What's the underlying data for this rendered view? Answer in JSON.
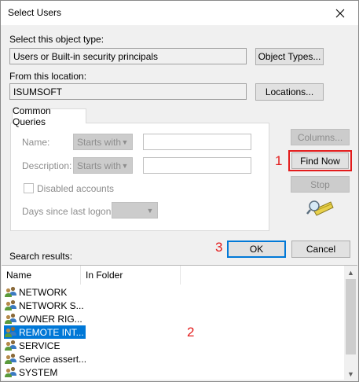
{
  "window": {
    "title": "Select Users"
  },
  "object_type": {
    "label": "Select this object type:",
    "value": "Users or Built-in security principals",
    "button": "Object Types..."
  },
  "location": {
    "label": "From this location:",
    "value": "ISUMSOFT",
    "button": "Locations..."
  },
  "queries": {
    "tab": "Common Queries",
    "name_label": "Name:",
    "description_label": "Description:",
    "starts_with": "Starts with",
    "disabled_accounts": "Disabled accounts",
    "days_label": "Days since last logon:"
  },
  "side_buttons": {
    "columns": "Columns...",
    "find_now": "Find Now",
    "stop": "Stop"
  },
  "dialog_buttons": {
    "ok": "OK",
    "cancel": "Cancel"
  },
  "annotations": {
    "step1": "1",
    "step2": "2",
    "step3": "3",
    "color": "#e31c1c"
  },
  "results": {
    "label": "Search results:",
    "columns": [
      "Name",
      "In Folder"
    ],
    "rows": [
      {
        "name": "NETWORK",
        "folder": ""
      },
      {
        "name": "NETWORK S...",
        "folder": ""
      },
      {
        "name": "OWNER RIG...",
        "folder": ""
      },
      {
        "name": "REMOTE INT...",
        "folder": "",
        "selected": true
      },
      {
        "name": "SERVICE",
        "folder": ""
      },
      {
        "name": "Service assert...",
        "folder": ""
      },
      {
        "name": "SYSTEM",
        "folder": ""
      }
    ]
  },
  "colors": {
    "accent": "#0078d7",
    "dialog_bg": "#f0f0f0"
  }
}
